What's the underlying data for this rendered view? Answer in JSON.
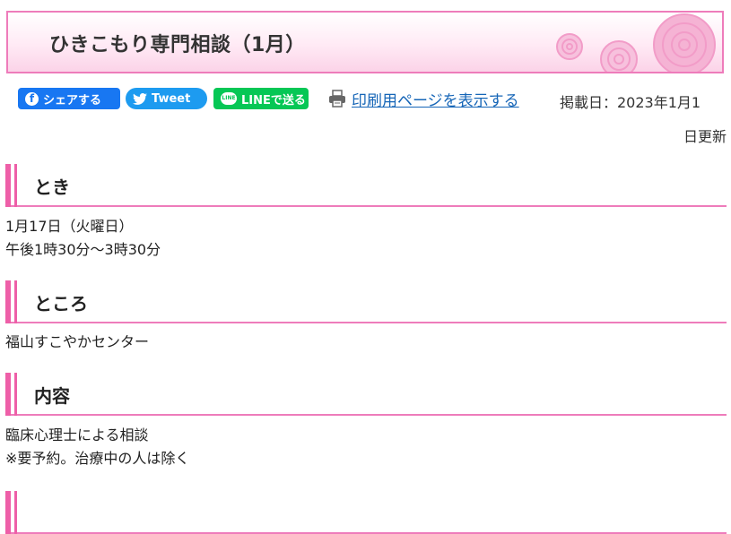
{
  "page": {
    "title": "ひきこもり専門相談（1月）"
  },
  "share": {
    "facebook_label": "シェアする",
    "twitter_label": "Tweet",
    "line_label": "LINEで送る",
    "line_icon_text": "LINE",
    "print_label": "印刷用ページを表示する"
  },
  "updated": {
    "line1": "掲載日：2023年1月1",
    "line2": "日更新"
  },
  "sections": [
    {
      "heading": "とき",
      "lines": [
        "1月17日（火曜日）",
        "午後1時30分～3時30分"
      ]
    },
    {
      "heading": "ところ",
      "lines": [
        "福山すこやかセンター"
      ]
    },
    {
      "heading": "内容",
      "lines": [
        "臨床心理士による相談",
        "※要予約。治療中の人は除く"
      ]
    }
  ],
  "colors": {
    "accent_pink": "#ee5fa8",
    "border_pink": "#ee7cbb",
    "facebook_blue": "#1877f2",
    "twitter_blue": "#1d9bf0",
    "line_green": "#06c755",
    "link_blue": "#1565b7"
  },
  "icons": {
    "facebook": "facebook-icon",
    "twitter": "twitter-bird-icon",
    "line": "line-icon",
    "print": "printer-icon",
    "banner": "rose-decoration-icon"
  }
}
